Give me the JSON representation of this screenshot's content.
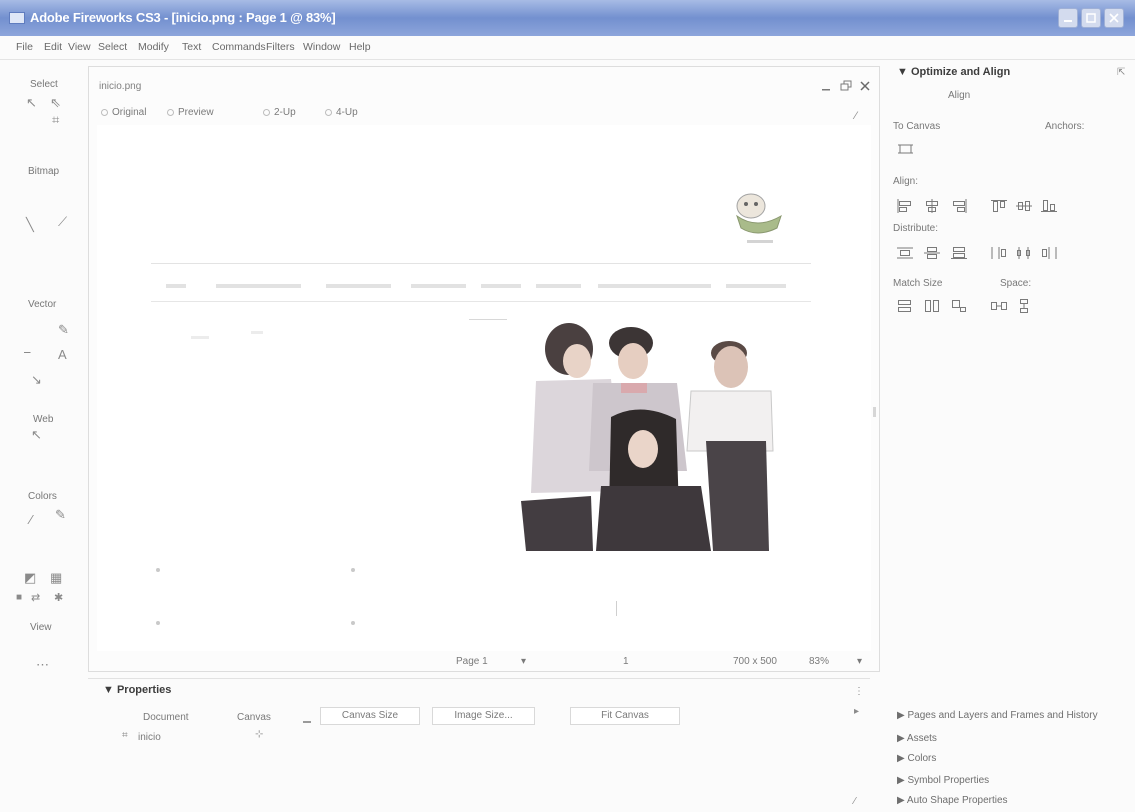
{
  "window": {
    "title": "Adobe Fireworks CS3 - [inicio.png : Page 1 @ 83%]"
  },
  "menu": {
    "items": [
      "File",
      "Edit",
      "View",
      "Select",
      "Modify",
      "Text",
      "Commands",
      "Filters",
      "Window",
      "Help"
    ]
  },
  "tools": {
    "select": "Select",
    "bitmap": "Bitmap",
    "vector": "Vector",
    "web": "Web",
    "colors": "Colors",
    "view": "View"
  },
  "document": {
    "title": "inicio.png",
    "tabs": [
      "Original",
      "Preview",
      "2-Up",
      "4-Up"
    ],
    "status": {
      "page": "Page 1",
      "frame": "1",
      "canvas_size": "700 x 500",
      "zoom": "83%"
    }
  },
  "properties": {
    "title": "Properties",
    "type": "Document",
    "canvas_label": "Canvas",
    "canvas_size_button": "Canvas Size",
    "image_size_button": "Image Size...",
    "fit_canvas_button": "Fit Canvas",
    "document_name": "inicio"
  },
  "optimize_align": {
    "title": "Optimize and Align",
    "section": "Align",
    "to_canvas": "To Canvas",
    "anchors": "Anchors:",
    "align": "Align:",
    "distribute": "Distribute:",
    "match_size": "Match Size",
    "space": "Space:"
  },
  "collapsed_panels": [
    "Pages and Layers and Frames and History",
    "Assets",
    "Colors",
    "Symbol Properties",
    "Auto Shape Properties"
  ],
  "colors": {
    "title_bar": "#7390cf",
    "canvas": "#ffffff",
    "panel_text": "#707070"
  }
}
